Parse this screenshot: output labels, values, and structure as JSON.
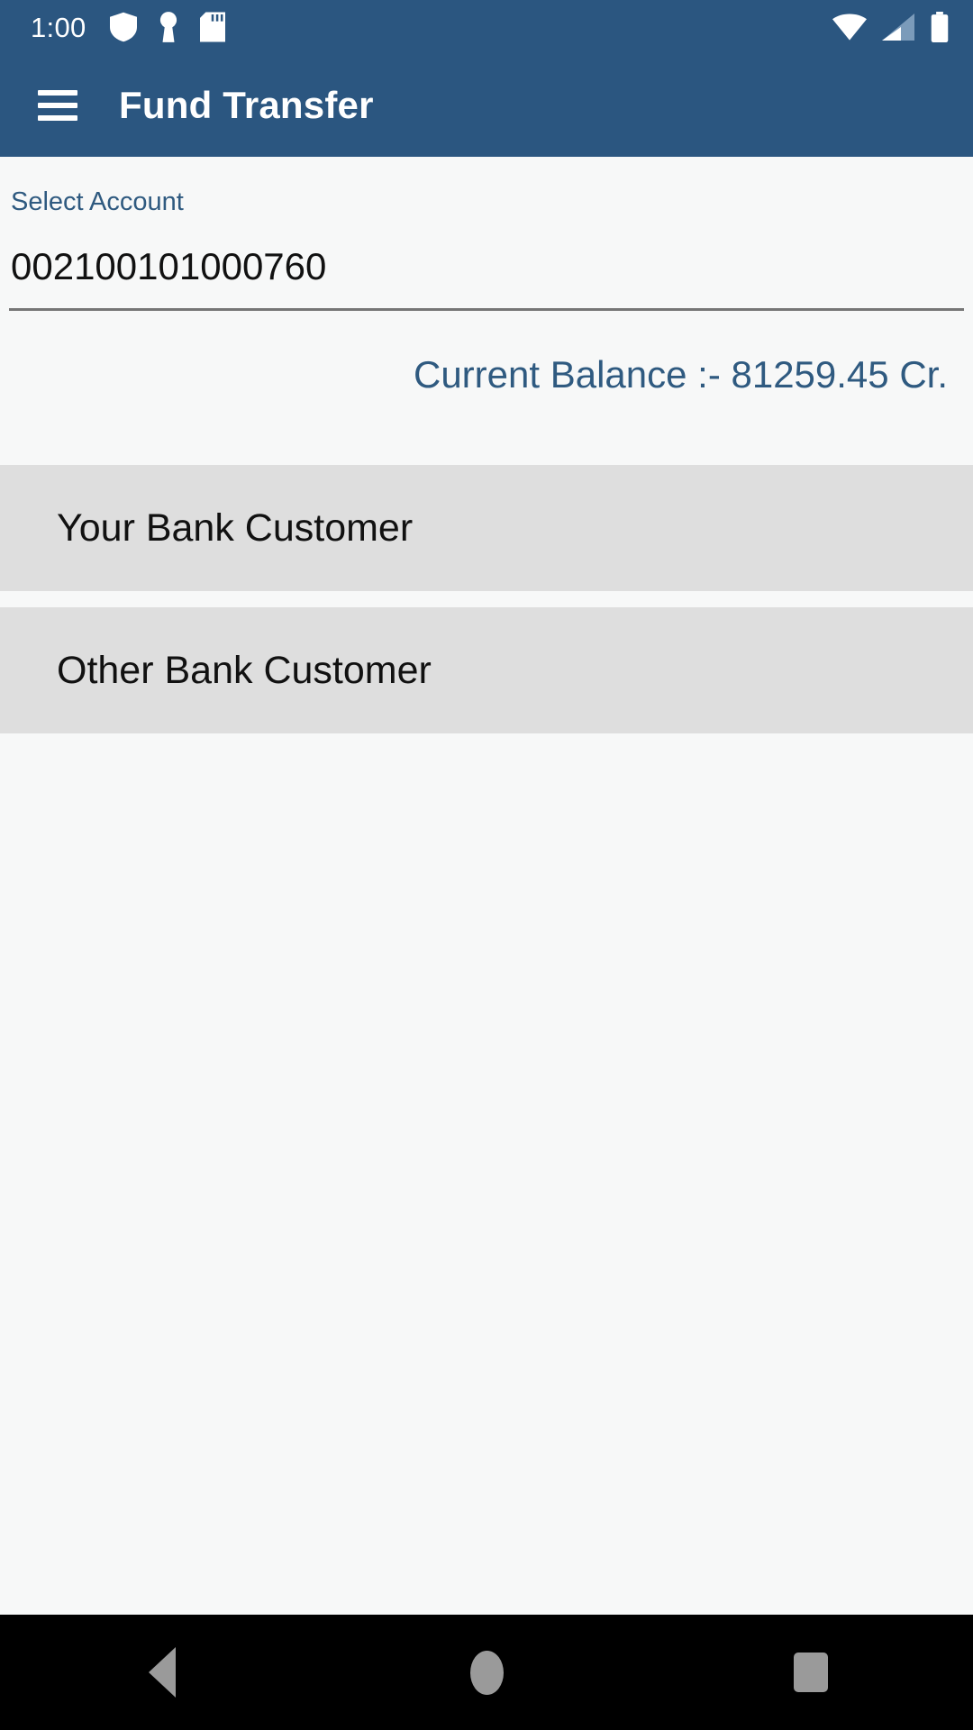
{
  "status_bar": {
    "clock": "1:00",
    "left_icons": [
      "shield-icon",
      "keyhole-vpn-icon",
      "sd-card-icon"
    ],
    "right_icons": [
      "wifi-icon",
      "cellular-signal-icon",
      "battery-icon"
    ],
    "background_color": "#2b5680"
  },
  "app_bar": {
    "menu_icon": "hamburger-menu-icon",
    "title": "Fund Transfer",
    "background_color": "#2b5680",
    "text_color": "#ffffff"
  },
  "form": {
    "account_label": "Select Account",
    "account_value": "002100101000760",
    "label_color": "#2f5a80"
  },
  "balance": {
    "text": "Current Balance :- 81259.45 Cr.",
    "color": "#2f5a80"
  },
  "options": {
    "items": [
      {
        "label": "Your Bank Customer"
      },
      {
        "label": "Other Bank Customer"
      }
    ],
    "card_color": "#dedede"
  },
  "nav_bar": {
    "back": "back-button",
    "home": "home-button",
    "recents": "recents-button",
    "background_color": "#000000",
    "icon_color": "#9a9a9a"
  }
}
